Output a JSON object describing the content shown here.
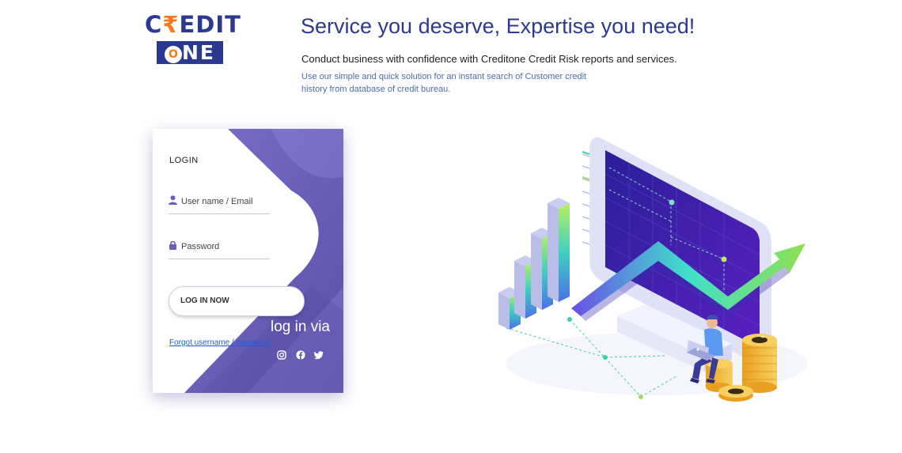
{
  "logo": {
    "credit_prefix": "C",
    "credit_rupee": "₹",
    "credit_suffix": "EDIT",
    "one_o": "O",
    "one_rest": "NE"
  },
  "header": {
    "headline": "Service you deserve, Expertise you need!",
    "subhead": "Conduct business with confidence with Creditone Credit Risk reports and services.",
    "description": "Use our simple and quick solution for an instant search of Customer credit history from database of credit bureau."
  },
  "login": {
    "title": "LOGIN",
    "username_placeholder": "User name / Email",
    "password_placeholder": "Password",
    "button_label": "LOG IN NOW",
    "via_label": "log in via",
    "forgot_label": "Forgot username / password"
  },
  "social": [
    "instagram-icon",
    "facebook-icon",
    "twitter-icon"
  ],
  "colors": {
    "brand": "#2b3990",
    "accent": "#f47b20",
    "card_purple": "#6a5fb8",
    "link": "#1a5fd6"
  }
}
